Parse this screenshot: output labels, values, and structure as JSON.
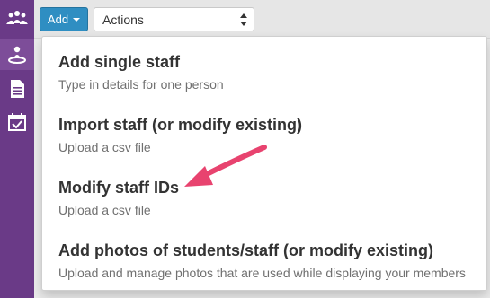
{
  "toolbar": {
    "add_label": "Add",
    "actions_value": "Actions"
  },
  "sidebar": {
    "icons": [
      "group-icon",
      "user-location-icon",
      "document-icon",
      "calendar-check-icon"
    ]
  },
  "menu": {
    "items": [
      {
        "title": "Add single staff",
        "subtitle": "Type in details for one person"
      },
      {
        "title": "Import staff (or modify existing)",
        "subtitle": "Upload a csv file"
      },
      {
        "title": "Modify staff IDs",
        "subtitle": "Upload a csv file"
      },
      {
        "title": "Add photos of students/staff (or modify existing)",
        "subtitle": "Upload and manage photos that are used while displaying your members"
      }
    ]
  },
  "colors": {
    "sidebar": "#6a3a87",
    "add_button": "#2f8ec2",
    "annotation_arrow": "#e8436f"
  }
}
